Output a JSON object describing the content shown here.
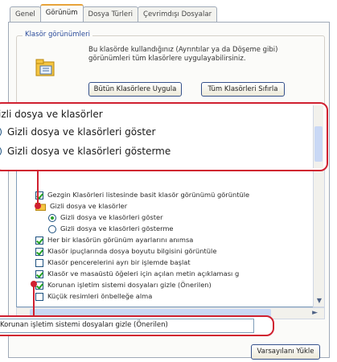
{
  "tabs": [
    {
      "label": "Genel",
      "active": false
    },
    {
      "label": "Görünüm",
      "active": true
    },
    {
      "label": "Dosya Türleri",
      "active": false
    },
    {
      "label": "Çevrimdışı Dosyalar",
      "active": false
    }
  ],
  "folder_views": {
    "title": "Klasör görünümleri",
    "description": "Bu klasörde kullandığınız (Ayrıntılar ya da Döşeme gibi) görünümleri tüm klasörlere uygulayabilirsiniz.",
    "apply_button": "Bütün Klasörlere Uygula",
    "reset_button": "Tüm Klasörleri Sıfırla"
  },
  "settings_rows": [
    {
      "type": "checkbox",
      "checked": true,
      "label": "Gezgin Klasörleri listesinde basit klasör görünümü görüntüle",
      "indent": 0
    },
    {
      "type": "folder",
      "label": "Gizli dosya ve klasörler",
      "indent": 0
    },
    {
      "type": "radio",
      "checked": true,
      "label": "Gizli dosya ve klasörleri göster",
      "indent": 1
    },
    {
      "type": "radio",
      "checked": false,
      "label": "Gizli dosya ve klasörleri gösterme",
      "indent": 1
    },
    {
      "type": "checkbox",
      "checked": true,
      "label": "Her bir klasörün görünüm ayarlarını anımsa",
      "indent": 0
    },
    {
      "type": "checkbox",
      "checked": true,
      "label": "Klasör ipuçlarında dosya boyutu bilgisini görüntüle",
      "indent": 0
    },
    {
      "type": "checkbox",
      "checked": false,
      "label": "Klasör pencerelerini ayrı bir işlemde başlat",
      "indent": 0
    },
    {
      "type": "checkbox",
      "checked": true,
      "label": "Klasör ve masaüstü öğeleri için açılan metin açıklaması g",
      "indent": 0
    },
    {
      "type": "checkbox",
      "checked": true,
      "label": "Korunan işletim sistemi dosyaları gizle (Önerilen)",
      "indent": 0
    },
    {
      "type": "checkbox",
      "checked": false,
      "label": "Küçük resimleri önbelleğe alma",
      "indent": 0
    }
  ],
  "default_button": "Varsayılanı Yükle",
  "zoom_top": {
    "heading": "izli dosya ve klasörler",
    "option_show": "Gizli dosya ve klasörleri göster",
    "option_hide": "Gizli dosya ve klasörleri gösterme"
  },
  "zoom_bottom": {
    "text": "Korunan işletim sistemi dosyaları gizle (Önerilen)"
  },
  "colors": {
    "callout_border": "#d02030",
    "active_tab_accent": "#e8a33a",
    "check_green": "#21a121"
  }
}
